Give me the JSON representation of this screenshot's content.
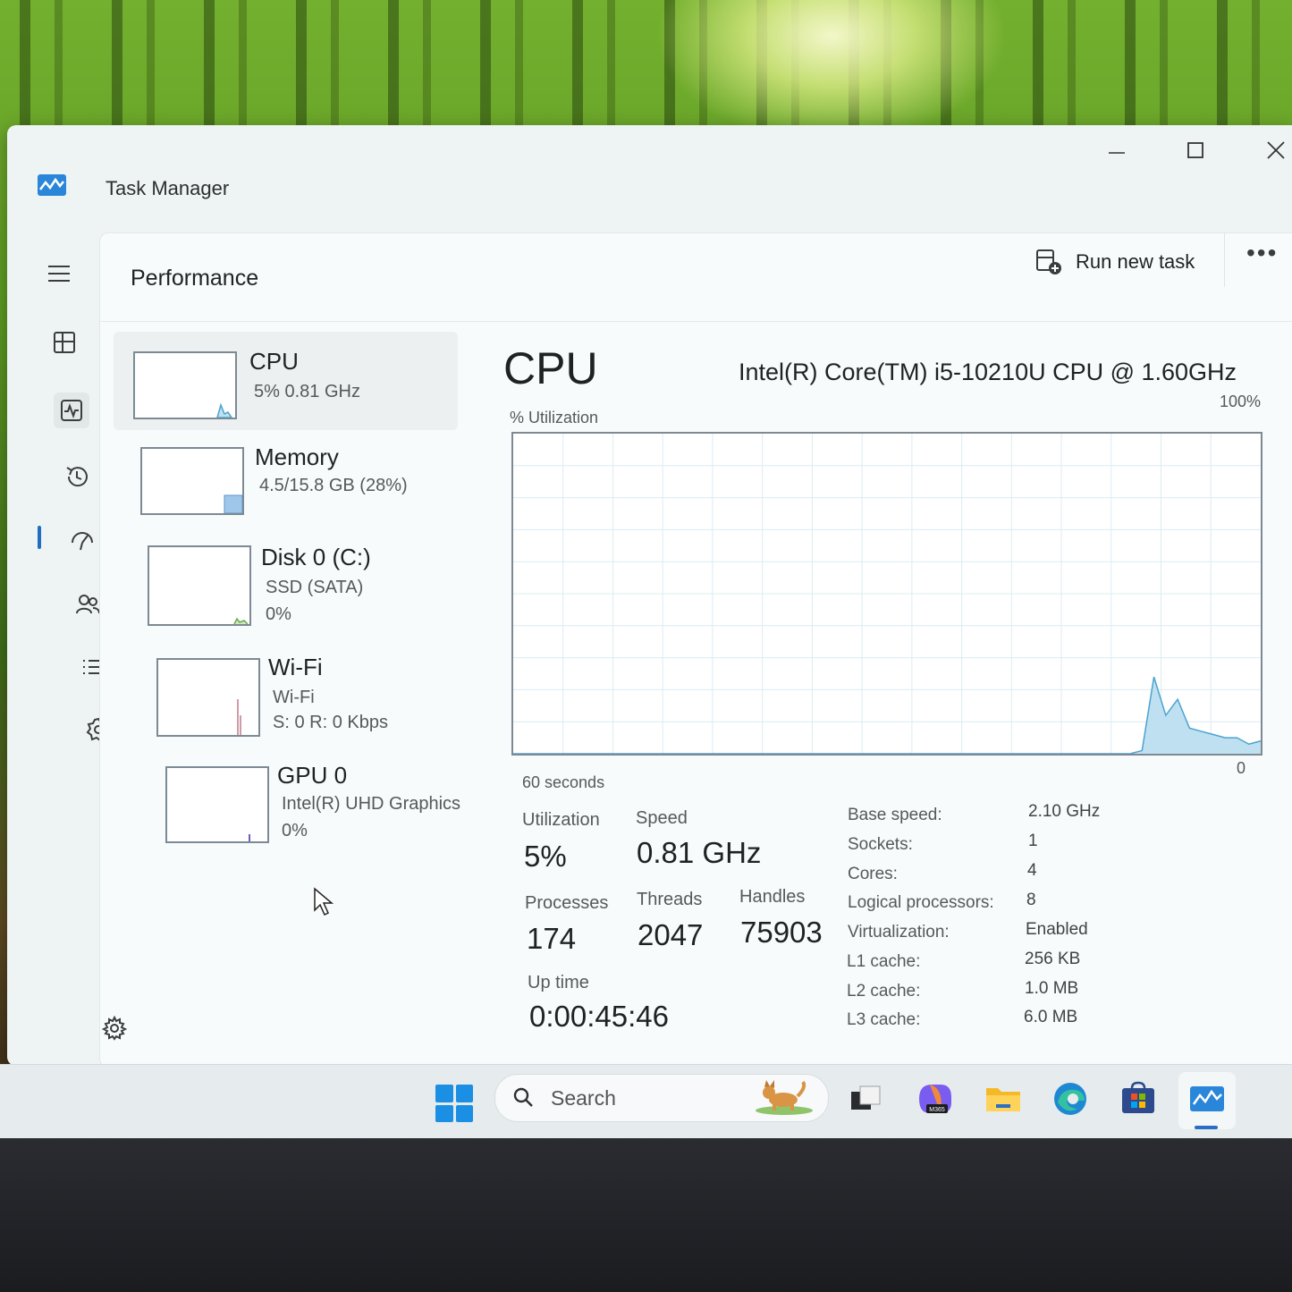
{
  "window": {
    "title": "Task Manager"
  },
  "header": {
    "page_title": "Performance",
    "run_new_task": "Run new task",
    "more": "•••"
  },
  "devices": [
    {
      "name": "CPU",
      "line1": "5%  0.81 GHz",
      "line2": ""
    },
    {
      "name": "Memory",
      "line1": "4.5/15.8 GB (28%)",
      "line2": ""
    },
    {
      "name": "Disk 0 (C:)",
      "line1": "SSD (SATA)",
      "line2": "0%"
    },
    {
      "name": "Wi-Fi",
      "line1": "Wi-Fi",
      "line2": "S: 0  R: 0 Kbps"
    },
    {
      "name": "GPU 0",
      "line1": "Intel(R) UHD Graphics",
      "line2": "0%"
    }
  ],
  "cpu": {
    "title": "CPU",
    "model": "Intel(R) Core(TM) i5-10210U CPU @ 1.60GHz",
    "graph": {
      "y_label": "% Utilization",
      "y_max_label": "100%",
      "y_min_label": "0",
      "x_label": "60 seconds",
      "values": [
        0,
        0,
        0,
        0,
        0,
        0,
        0,
        0,
        0,
        0,
        0,
        0,
        0,
        0,
        0,
        0,
        0,
        0,
        0,
        0,
        0,
        0,
        0,
        0,
        0,
        0,
        0,
        0,
        0,
        0,
        0,
        0,
        0,
        0,
        0,
        0,
        0,
        0,
        0,
        0,
        0,
        0,
        0,
        0,
        0,
        0,
        0,
        0,
        0,
        0,
        0,
        0,
        0,
        1,
        24,
        12,
        17,
        8,
        7,
        6,
        5,
        5,
        3,
        4
      ]
    },
    "stats": {
      "utilization_label": "Utilization",
      "utilization": "5%",
      "speed_label": "Speed",
      "speed": "0.81 GHz",
      "processes_label": "Processes",
      "processes": "174",
      "threads_label": "Threads",
      "threads": "2047",
      "handles_label": "Handles",
      "handles": "75903",
      "uptime_label": "Up time",
      "uptime": "0:00:45:46"
    },
    "specs": [
      {
        "label": "Base speed:",
        "value": "2.10 GHz"
      },
      {
        "label": "Sockets:",
        "value": "1"
      },
      {
        "label": "Cores:",
        "value": "4"
      },
      {
        "label": "Logical processors:",
        "value": "8"
      },
      {
        "label": "Virtualization:",
        "value": "Enabled"
      },
      {
        "label": "L1 cache:",
        "value": "256 KB"
      },
      {
        "label": "L2 cache:",
        "value": "1.0 MB"
      },
      {
        "label": "L3 cache:",
        "value": "6.0 MB"
      }
    ]
  },
  "taskbar": {
    "search_placeholder": "Search"
  },
  "colors": {
    "accent": "#1f6ec2",
    "graph_fill": "#bfe0f0",
    "graph_line": "#4aa3d1",
    "grid": "#dcecf2"
  }
}
